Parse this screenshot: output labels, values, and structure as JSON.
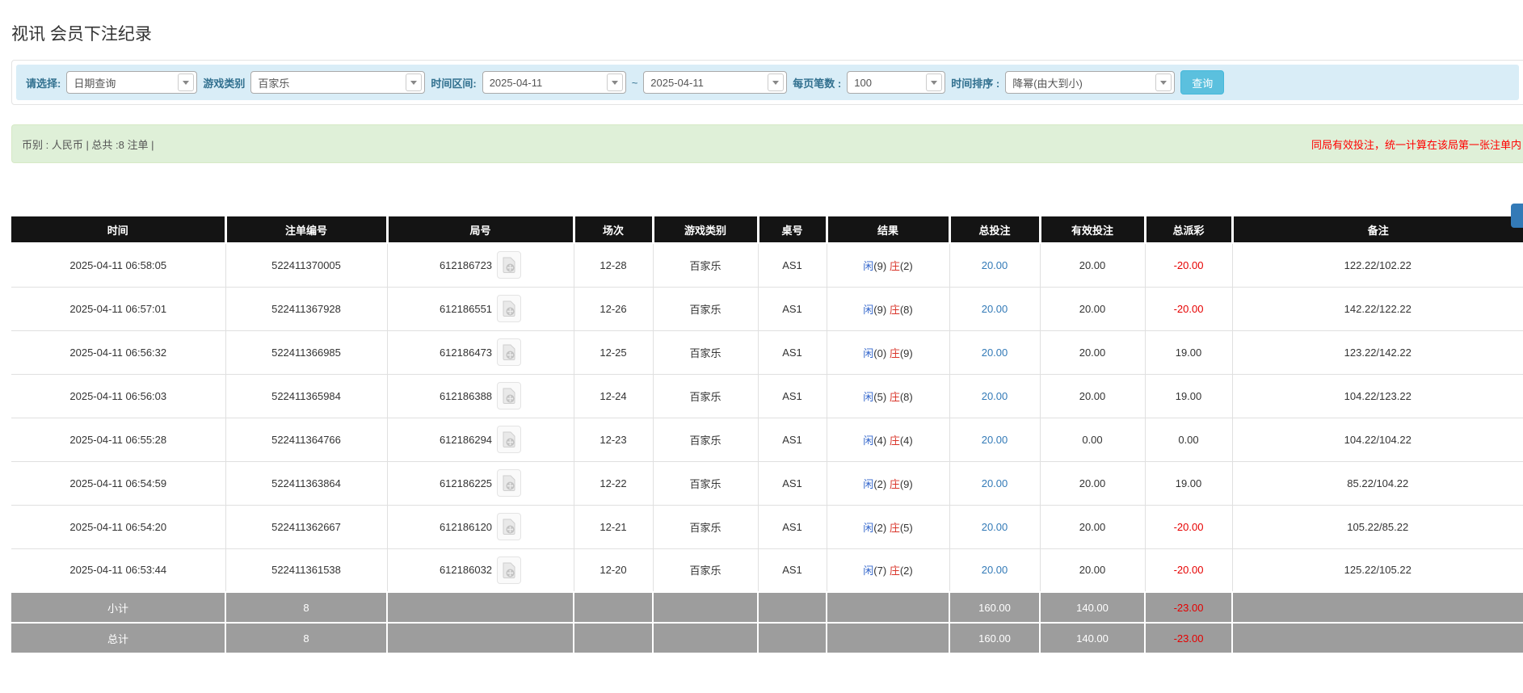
{
  "page": {
    "title": "视讯 会员下注纪录"
  },
  "filters": {
    "select_label": "请选择:",
    "select_value": "日期查询",
    "game_label": "游戏类别",
    "game_value": "百家乐",
    "range_label": "时间区间:",
    "date_from": "2025-04-11",
    "tilde": "~",
    "date_to": "2025-04-11",
    "per_page_label": "每页笔数 :",
    "per_page_value": "100",
    "sort_label": "时间排序 :",
    "sort_value": "降幂(由大到小)",
    "search_button": "查询"
  },
  "summary": {
    "left": "币别 : 人民币 | 总共 :8 注单 |",
    "notice": "同局有效投注，统一计算在该局第一张注单内"
  },
  "table": {
    "headers": {
      "time": "时间",
      "bet_no": "注单编号",
      "round_no": "局号",
      "session": "场次",
      "game": "游戏类别",
      "table_no": "桌号",
      "result": "结果",
      "total_bet": "总投注",
      "valid_bet": "有效投注",
      "payout": "总派彩",
      "remark": "备注"
    },
    "rows": [
      {
        "time": "2025-04-11 06:58:05",
        "bet_no": "522411370005",
        "round_no": "612186723",
        "session": "12-28",
        "game": "百家乐",
        "table_no": "AS1",
        "result": {
          "player": "闲",
          "player_score": "(9)",
          "banker": "庄",
          "banker_score": "(2)"
        },
        "total_bet": "20.00",
        "valid_bet": "20.00",
        "payout": "-20.00",
        "remark": "122.22/102.22"
      },
      {
        "time": "2025-04-11 06:57:01",
        "bet_no": "522411367928",
        "round_no": "612186551",
        "session": "12-26",
        "game": "百家乐",
        "table_no": "AS1",
        "result": {
          "player": "闲",
          "player_score": "(9)",
          "banker": "庄",
          "banker_score": "(8)"
        },
        "total_bet": "20.00",
        "valid_bet": "20.00",
        "payout": "-20.00",
        "remark": "142.22/122.22"
      },
      {
        "time": "2025-04-11 06:56:32",
        "bet_no": "522411366985",
        "round_no": "612186473",
        "session": "12-25",
        "game": "百家乐",
        "table_no": "AS1",
        "result": {
          "player": "闲",
          "player_score": "(0)",
          "banker": "庄",
          "banker_score": "(9)"
        },
        "total_bet": "20.00",
        "valid_bet": "20.00",
        "payout": "19.00",
        "remark": "123.22/142.22"
      },
      {
        "time": "2025-04-11 06:56:03",
        "bet_no": "522411365984",
        "round_no": "612186388",
        "session": "12-24",
        "game": "百家乐",
        "table_no": "AS1",
        "result": {
          "player": "闲",
          "player_score": "(5)",
          "banker": "庄",
          "banker_score": "(8)"
        },
        "total_bet": "20.00",
        "valid_bet": "20.00",
        "payout": "19.00",
        "remark": "104.22/123.22"
      },
      {
        "time": "2025-04-11 06:55:28",
        "bet_no": "522411364766",
        "round_no": "612186294",
        "session": "12-23",
        "game": "百家乐",
        "table_no": "AS1",
        "result": {
          "player": "闲",
          "player_score": "(4)",
          "banker": "庄",
          "banker_score": "(4)"
        },
        "total_bet": "20.00",
        "valid_bet": "0.00",
        "payout": "0.00",
        "remark": "104.22/104.22"
      },
      {
        "time": "2025-04-11 06:54:59",
        "bet_no": "522411363864",
        "round_no": "612186225",
        "session": "12-22",
        "game": "百家乐",
        "table_no": "AS1",
        "result": {
          "player": "闲",
          "player_score": "(2)",
          "banker": "庄",
          "banker_score": "(9)"
        },
        "total_bet": "20.00",
        "valid_bet": "20.00",
        "payout": "19.00",
        "remark": "85.22/104.22"
      },
      {
        "time": "2025-04-11 06:54:20",
        "bet_no": "522411362667",
        "round_no": "612186120",
        "session": "12-21",
        "game": "百家乐",
        "table_no": "AS1",
        "result": {
          "player": "闲",
          "player_score": "(2)",
          "banker": "庄",
          "banker_score": "(5)"
        },
        "total_bet": "20.00",
        "valid_bet": "20.00",
        "payout": "-20.00",
        "remark": "105.22/85.22"
      },
      {
        "time": "2025-04-11 06:53:44",
        "bet_no": "522411361538",
        "round_no": "612186032",
        "session": "12-20",
        "game": "百家乐",
        "table_no": "AS1",
        "result": {
          "player": "闲",
          "player_score": "(7)",
          "banker": "庄",
          "banker_score": "(2)"
        },
        "total_bet": "20.00",
        "valid_bet": "20.00",
        "payout": "-20.00",
        "remark": "125.22/105.22"
      }
    ],
    "footer": {
      "subtotal_label": "小计",
      "total_label": "总计",
      "count": "8",
      "total_bet": "160.00",
      "valid_bet": "140.00",
      "payout": "-23.00"
    }
  }
}
